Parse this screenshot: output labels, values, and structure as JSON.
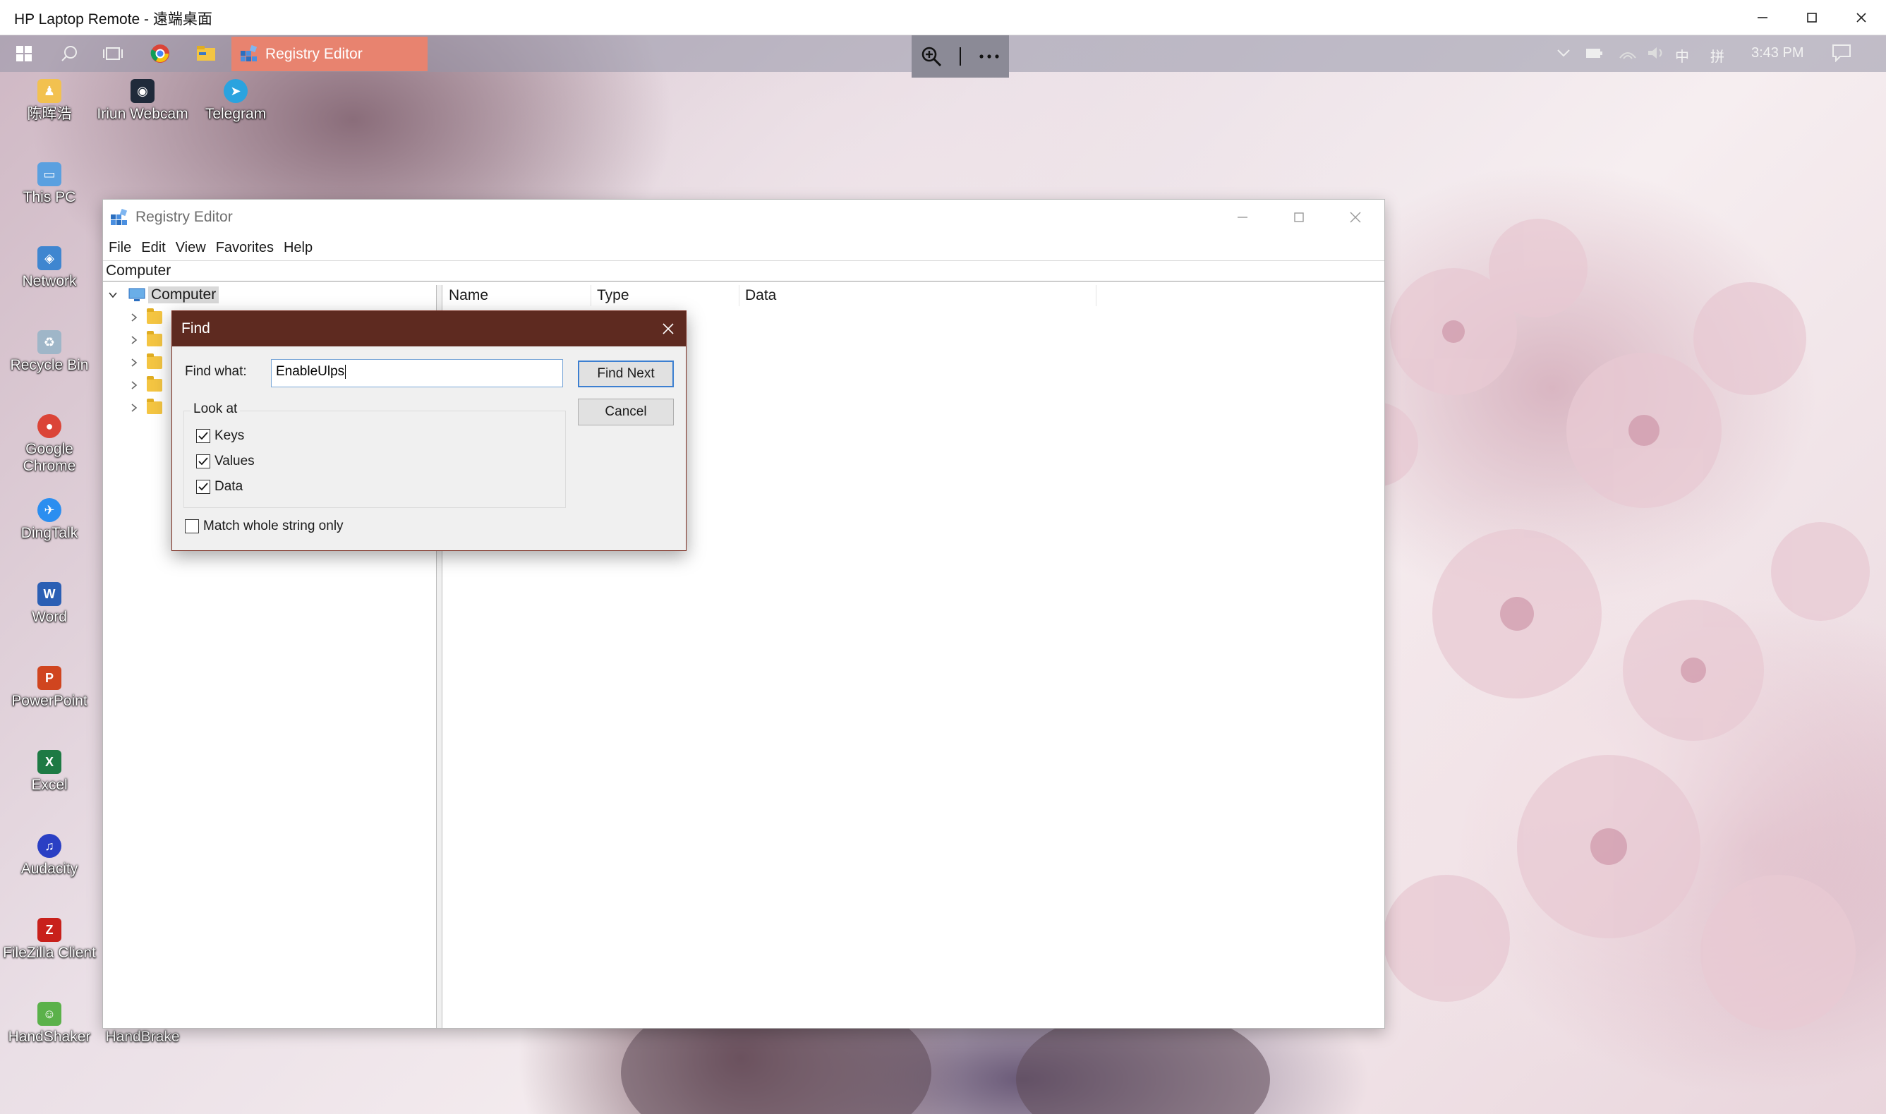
{
  "outer_window": {
    "title": "HP Laptop Remote - 遠端桌面"
  },
  "taskbar": {
    "active_app_label": "Registry Editor",
    "tray": {
      "ime_primary": "中",
      "ime_secondary": "拼",
      "time": "3:43 PM"
    }
  },
  "desktop_icons": {
    "user_folder": "陈晖浩",
    "iriun_webcam": "Iriun Webcam",
    "telegram": "Telegram",
    "this_pc": "This PC",
    "network": "Network",
    "recycle_bin": "Recycle Bin",
    "google_chrome": "Google Chrome",
    "dingtalk": "DingTalk",
    "word": "Word",
    "powerpoint": "PowerPoint",
    "excel": "Excel",
    "audacity": "Audacity",
    "filezilla": "FileZilla Client",
    "handshaker": "HandShaker",
    "handbrake": "HandBrake"
  },
  "regedit": {
    "title": "Registry Editor",
    "menu": [
      "File",
      "Edit",
      "View",
      "Favorites",
      "Help"
    ],
    "address": "Computer",
    "tree_root": "Computer",
    "columns": [
      "Name",
      "Type",
      "Data"
    ]
  },
  "find_dialog": {
    "title": "Find",
    "find_what_label": "Find what:",
    "find_what_value": "EnableUlps",
    "find_next_label": "Find Next",
    "cancel_label": "Cancel",
    "look_at_label": "Look at",
    "keys_label": "Keys",
    "values_label": "Values",
    "data_label": "Data",
    "keys_checked": true,
    "values_checked": true,
    "data_checked": true,
    "match_whole_label": "Match whole string only",
    "match_whole_checked": false
  },
  "colors": {
    "find_titlebar": "#5e2a20",
    "taskbar_active_app": "#e8836f",
    "accent_blue": "#3c7fd1"
  }
}
